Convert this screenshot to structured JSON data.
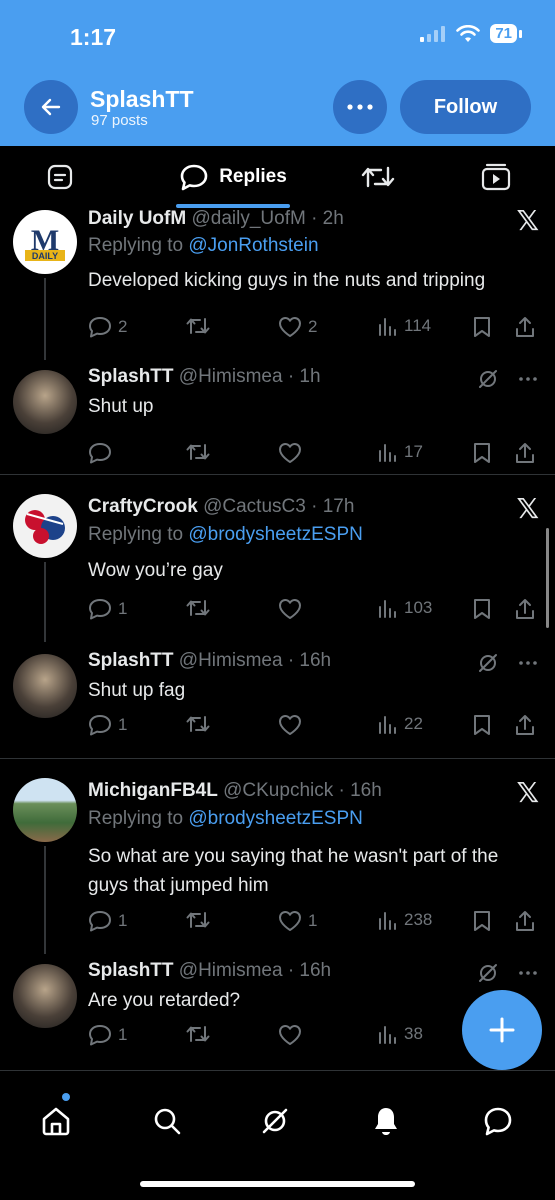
{
  "status_bar": {
    "time": "1:17",
    "battery": "71"
  },
  "header": {
    "name": "SplashTT",
    "posts": "97 posts",
    "follow_label": "Follow"
  },
  "tabs": {
    "replies_label": "Replies"
  },
  "tweets": [
    {
      "name": "Daily UofM",
      "handle": "@daily_UofM · 2h",
      "replying_prefix": "Replying to ",
      "replying_to": "@JonRothstein",
      "text": "Developed kicking guys in the nuts and tripping",
      "replies": "2",
      "retweets": "",
      "likes": "2",
      "views": "114"
    },
    {
      "name": "SplashTT",
      "handle": "@Himismea · 1h",
      "text": "Shut up",
      "replies": "",
      "retweets": "",
      "likes": "",
      "views": "17"
    },
    {
      "name": "CraftyCrook",
      "handle": "@CactusC3 · 17h",
      "replying_prefix": "Replying to ",
      "replying_to": "@brodysheetzESPN",
      "text": "Wow you’re gay",
      "replies": "1",
      "retweets": "",
      "likes": "",
      "views": "103"
    },
    {
      "name": "SplashTT",
      "handle": "@Himismea · 16h",
      "text": "Shut up fag",
      "replies": "1",
      "retweets": "",
      "likes": "",
      "views": "22"
    },
    {
      "name": "MichiganFB4L",
      "handle": "@CKupchick · 16h",
      "replying_prefix": "Replying to ",
      "replying_to": "@brodysheetzESPN",
      "text": "So what are you saying that he wasn't part of the guys that jumped him",
      "replies": "1",
      "retweets": "",
      "likes": "1",
      "views": "238"
    },
    {
      "name": "SplashTT",
      "handle": "@Himismea · 16h",
      "text": "Are you retarded?",
      "replies": "1",
      "retweets": "",
      "likes": "",
      "views": "38"
    }
  ],
  "avatar_logo_text": "M DAILY",
  "colors": {
    "accent": "#4a9ef0",
    "header_bg": "#4a9ef0",
    "button_bg": "#2f6fc4",
    "muted": "#71767b"
  }
}
